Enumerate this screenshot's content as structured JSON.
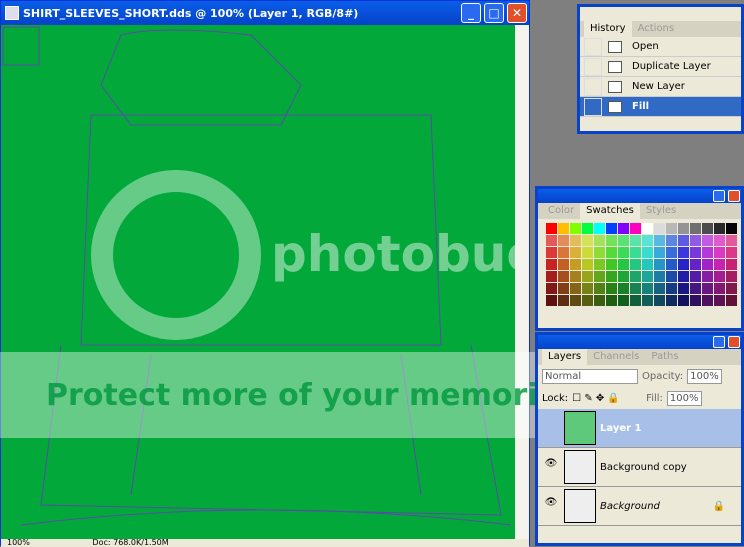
{
  "document": {
    "title": "SHIRT_SLEEVES_SHORT.dds @ 100% (Layer 1, RGB/8#)",
    "zoom": "100%",
    "doc_info": "Doc: 768.0K/1.50M",
    "fill_color": "#02a93a"
  },
  "history": {
    "tabs": [
      "History",
      "Actions"
    ],
    "items": [
      "Open",
      "Duplicate Layer",
      "New Layer",
      "Fill"
    ],
    "selected": "Fill"
  },
  "swatches": {
    "tabs": [
      "Color",
      "Swatches",
      "Styles"
    ]
  },
  "layers": {
    "tabs": [
      "Layers",
      "Channels",
      "Paths"
    ],
    "blend_mode": "Normal",
    "opacity_label": "Opacity:",
    "opacity": "100%",
    "lock_label": "Lock:",
    "fill_label": "Fill:",
    "fill": "100%",
    "items": [
      {
        "name": "Layer 1",
        "selected": true
      },
      {
        "name": "Background copy",
        "selected": false
      },
      {
        "name": "Background",
        "selected": false
      }
    ]
  },
  "watermark": {
    "logo": "photobucket",
    "banner": "Protect more of your memories for less!"
  }
}
